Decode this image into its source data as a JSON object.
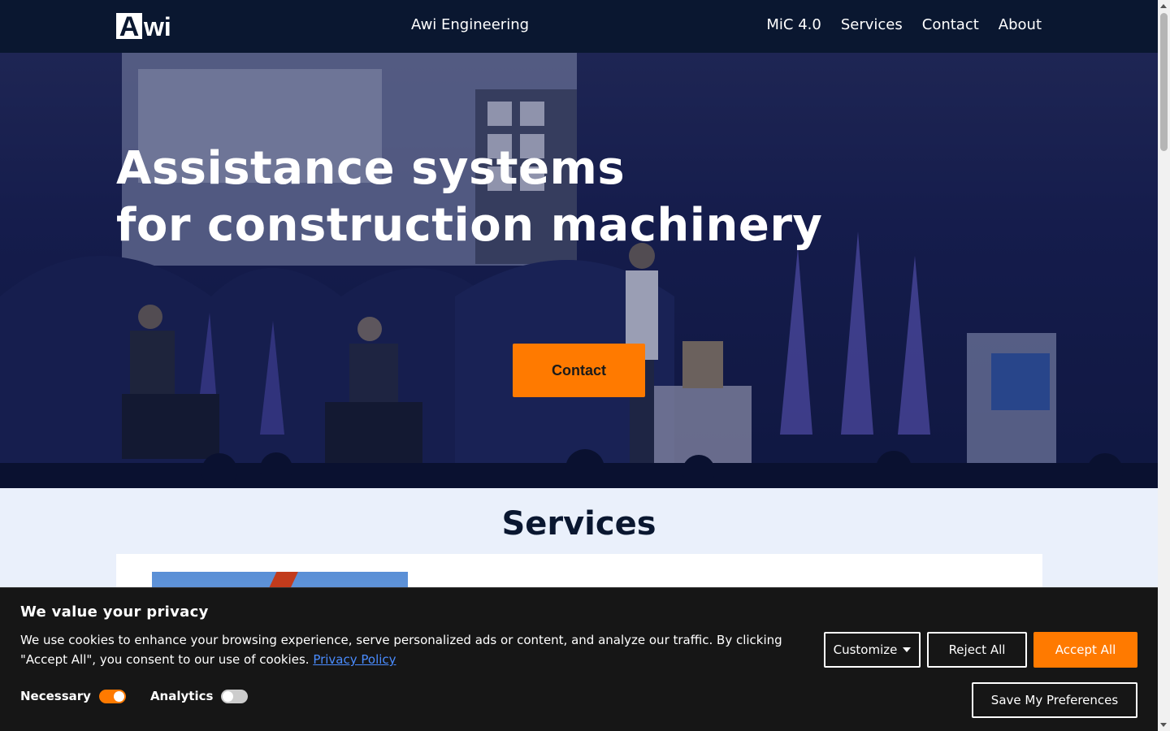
{
  "navbar": {
    "logo": {
      "first": "A",
      "rest": "wi"
    },
    "brand": "Awi Engineering",
    "links": [
      "MiC 4.0",
      "Services",
      "Contact",
      "About"
    ]
  },
  "hero": {
    "title_line1": "Assistance systems",
    "title_line2": "for construction machinery",
    "cta_label": "Contact"
  },
  "services": {
    "title": "Services"
  },
  "cookie_banner": {
    "title": "We value your privacy",
    "text": "We use cookies to enhance your browsing experience, serve personalized ads or content, and analyze our traffic. By clicking \"Accept All\", you consent to our use of cookies.",
    "privacy_link": "Privacy Policy",
    "toggles": [
      {
        "label": "Necessary",
        "on": true
      },
      {
        "label": "Analytics",
        "on": false
      }
    ],
    "buttons": {
      "customize": "Customize",
      "reject": "Reject All",
      "accept": "Accept All",
      "save": "Save My Preferences"
    }
  },
  "colors": {
    "navbar_bg": "#0a1730",
    "accent": "#ff7a00",
    "banner_bg": "#161616",
    "link": "#4a8cff"
  }
}
